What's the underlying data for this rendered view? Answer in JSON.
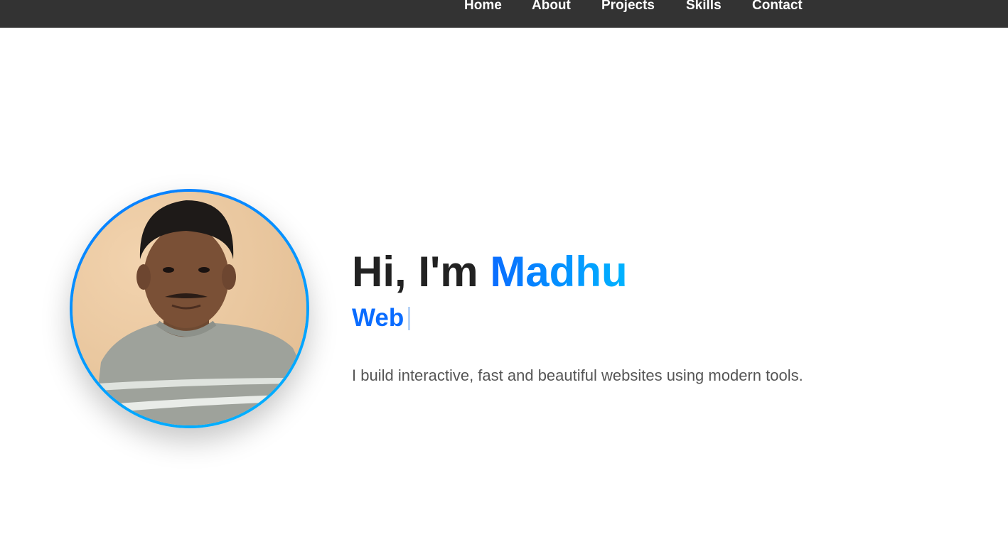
{
  "nav": {
    "items": [
      {
        "label": "Home"
      },
      {
        "label": "About"
      },
      {
        "label": "Projects"
      },
      {
        "label": "Skills"
      },
      {
        "label": "Contact"
      }
    ]
  },
  "hero": {
    "greeting_prefix": "Hi, I'm",
    "name": "Madhu",
    "typed_text": "Web",
    "tagline": "I build interactive, fast and beautiful websites using modern tools."
  },
  "colors": {
    "navbar_bg": "#333333",
    "accent": "#0a6cff",
    "accent_light": "#00b4ff"
  }
}
